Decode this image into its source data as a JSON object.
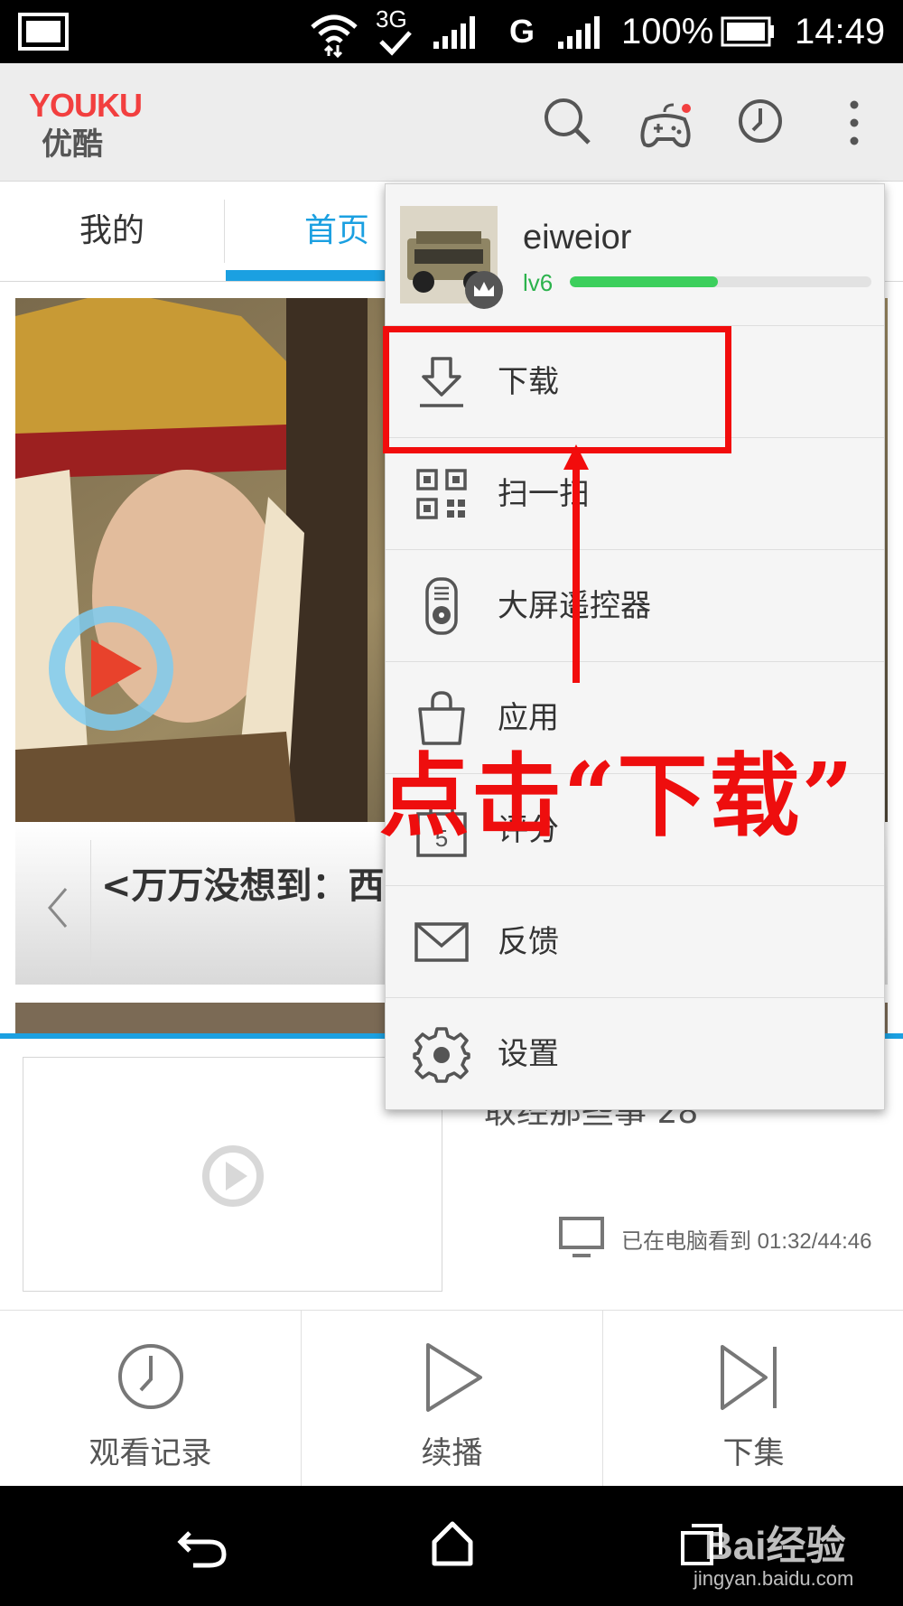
{
  "status_bar": {
    "network_3g": "3G",
    "network_g": "G",
    "battery": "100%",
    "time": "14:49"
  },
  "app_header": {
    "logo_en": "YOUKU",
    "logo_cn": "优酷",
    "icons": [
      "search-icon",
      "game-controller-icon",
      "history-clock-icon",
      "more-vert-icon"
    ]
  },
  "tabs": [
    {
      "label": "我的",
      "active": false
    },
    {
      "label": "首页",
      "active": true
    }
  ],
  "banner": {
    "caption": "<万万没想到：西"
  },
  "continue_watching": {
    "title_partial": "取经那些事 28",
    "progress": "已在电脑看到 01:32/44:46"
  },
  "bottom_actions": [
    {
      "label": "观看记录",
      "icon": "clock-icon"
    },
    {
      "label": "续播",
      "icon": "play-icon"
    },
    {
      "label": "下集",
      "icon": "next-icon"
    }
  ],
  "menu": {
    "user": {
      "name": "eiweior",
      "level": "lv6",
      "level_progress": 0.49
    },
    "items": [
      {
        "label": "下载",
        "icon": "download-icon"
      },
      {
        "label": "扫一扫",
        "icon": "qr-scan-icon"
      },
      {
        "label": "大屏遥控器",
        "icon": "remote-control-icon"
      },
      {
        "label": "应用",
        "icon": "shopping-bag-icon"
      },
      {
        "label": "评分",
        "icon": "rating-icon",
        "badge": "5"
      },
      {
        "label": "反馈",
        "icon": "mail-icon"
      },
      {
        "label": "设置",
        "icon": "gear-icon"
      }
    ]
  },
  "annotation": {
    "text": "点击“下载”"
  },
  "watermark": {
    "brand": "Bai经验",
    "url": "jingyan.baidu.com"
  },
  "colors": {
    "accent_blue": "#1ba0e1",
    "annotation_red": "#f20c0c",
    "level_green": "#3ccf5c"
  }
}
